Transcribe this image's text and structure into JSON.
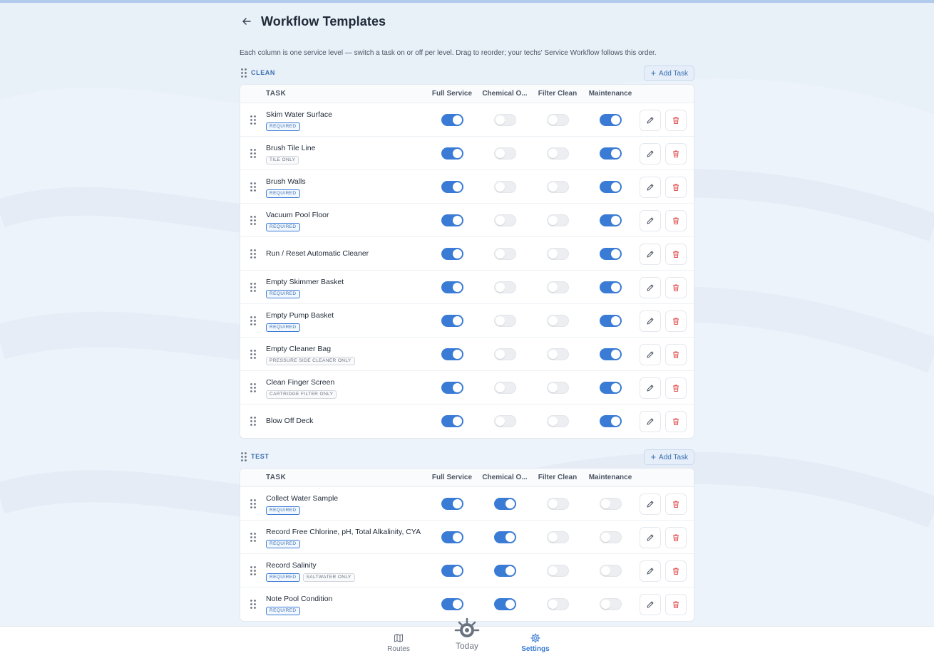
{
  "header": {
    "title": "Workflow Templates",
    "description": "Each column is one service level — switch a task on or off per level. Drag to reorder; your techs' Service Workflow follows this order."
  },
  "columns": [
    "Full Service",
    "Chemical O...",
    "Filter Clean",
    "Maintenance"
  ],
  "task_header": "TASK",
  "add_task_label": "Add Task",
  "sections": [
    {
      "name": "CLEAN",
      "tasks": [
        {
          "name": "Skim Water Surface",
          "badges": [
            {
              "text": "REQUIRED",
              "type": "req"
            }
          ],
          "toggles": [
            true,
            false,
            false,
            true
          ]
        },
        {
          "name": "Brush Tile Line",
          "badges": [
            {
              "text": "TILE ONLY",
              "type": "cond"
            }
          ],
          "toggles": [
            true,
            false,
            false,
            true
          ]
        },
        {
          "name": "Brush Walls",
          "badges": [
            {
              "text": "REQUIRED",
              "type": "req"
            }
          ],
          "toggles": [
            true,
            false,
            false,
            true
          ]
        },
        {
          "name": "Vacuum Pool Floor",
          "badges": [
            {
              "text": "REQUIRED",
              "type": "req"
            }
          ],
          "toggles": [
            true,
            false,
            false,
            true
          ]
        },
        {
          "name": "Run / Reset Automatic Cleaner",
          "badges": [],
          "toggles": [
            true,
            false,
            false,
            true
          ]
        },
        {
          "name": "Empty Skimmer Basket",
          "badges": [
            {
              "text": "REQUIRED",
              "type": "req"
            }
          ],
          "toggles": [
            true,
            false,
            false,
            true
          ]
        },
        {
          "name": "Empty Pump Basket",
          "badges": [
            {
              "text": "REQUIRED",
              "type": "req"
            }
          ],
          "toggles": [
            true,
            false,
            false,
            true
          ]
        },
        {
          "name": "Empty Cleaner Bag",
          "badges": [
            {
              "text": "PRESSURE SIDE CLEANER ONLY",
              "type": "cond"
            }
          ],
          "toggles": [
            true,
            false,
            false,
            true
          ]
        },
        {
          "name": "Clean Finger Screen",
          "badges": [
            {
              "text": "CARTRIDGE FILTER ONLY",
              "type": "cond"
            }
          ],
          "toggles": [
            true,
            false,
            false,
            true
          ]
        },
        {
          "name": "Blow Off Deck",
          "badges": [],
          "toggles": [
            true,
            false,
            false,
            true
          ]
        }
      ]
    },
    {
      "name": "TEST",
      "tasks": [
        {
          "name": "Collect Water Sample",
          "badges": [
            {
              "text": "REQUIRED",
              "type": "req"
            }
          ],
          "toggles": [
            true,
            true,
            false,
            false
          ]
        },
        {
          "name": "Record Free Chlorine, pH, Total Alkalinity, CYA",
          "badges": [
            {
              "text": "REQUIRED",
              "type": "req"
            }
          ],
          "toggles": [
            true,
            true,
            false,
            false
          ]
        },
        {
          "name": "Record Salinity",
          "badges": [
            {
              "text": "REQUIRED",
              "type": "req"
            },
            {
              "text": "SALTWATER ONLY",
              "type": "cond"
            }
          ],
          "toggles": [
            true,
            true,
            false,
            false
          ]
        },
        {
          "name": "Note Pool Condition",
          "badges": [
            {
              "text": "REQUIRED",
              "type": "req"
            }
          ],
          "toggles": [
            true,
            true,
            false,
            false
          ]
        }
      ]
    }
  ],
  "nav": {
    "routes": "Routes",
    "today": "Today",
    "settings": "Settings"
  },
  "colors": {
    "accent": "#3a7bd5",
    "background": "#edf3fa",
    "delete": "#e05252"
  }
}
